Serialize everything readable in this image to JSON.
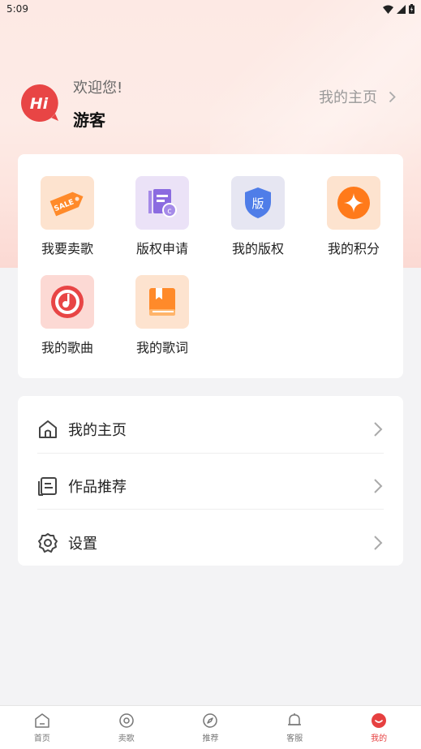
{
  "status_bar": {
    "time": "5:09"
  },
  "header": {
    "avatar_text": "Hi",
    "greeting": "欢迎您!",
    "username": "游客",
    "homepage_link": "我的主页"
  },
  "grid": {
    "items": [
      {
        "label": "我要卖歌",
        "icon": "sale-tag-icon",
        "badge": "SALE"
      },
      {
        "label": "版权申请",
        "icon": "copyright-doc-icon"
      },
      {
        "label": "我的版权",
        "icon": "shield-icon",
        "badge": "版"
      },
      {
        "label": "我的积分",
        "icon": "points-diamond-icon"
      },
      {
        "label": "我的歌曲",
        "icon": "music-disc-icon"
      },
      {
        "label": "我的歌词",
        "icon": "lyrics-book-icon"
      }
    ]
  },
  "list": {
    "items": [
      {
        "label": "我的主页",
        "icon": "home-icon"
      },
      {
        "label": "作品推荐",
        "icon": "document-list-icon"
      },
      {
        "label": "设置",
        "icon": "gear-icon"
      }
    ]
  },
  "tabbar": {
    "tabs": [
      {
        "label": "首页",
        "icon": "home-icon",
        "active": false
      },
      {
        "label": "卖歌",
        "icon": "disc-icon",
        "active": false
      },
      {
        "label": "推荐",
        "icon": "compass-icon",
        "active": false
      },
      {
        "label": "客服",
        "icon": "bell-icon",
        "active": false
      },
      {
        "label": "我的",
        "icon": "smile-icon",
        "active": true
      }
    ]
  },
  "colors": {
    "accent": "#e64040",
    "orange": "#ff8a2a",
    "purple": "#8b6be0",
    "blue": "#4f7de8"
  }
}
